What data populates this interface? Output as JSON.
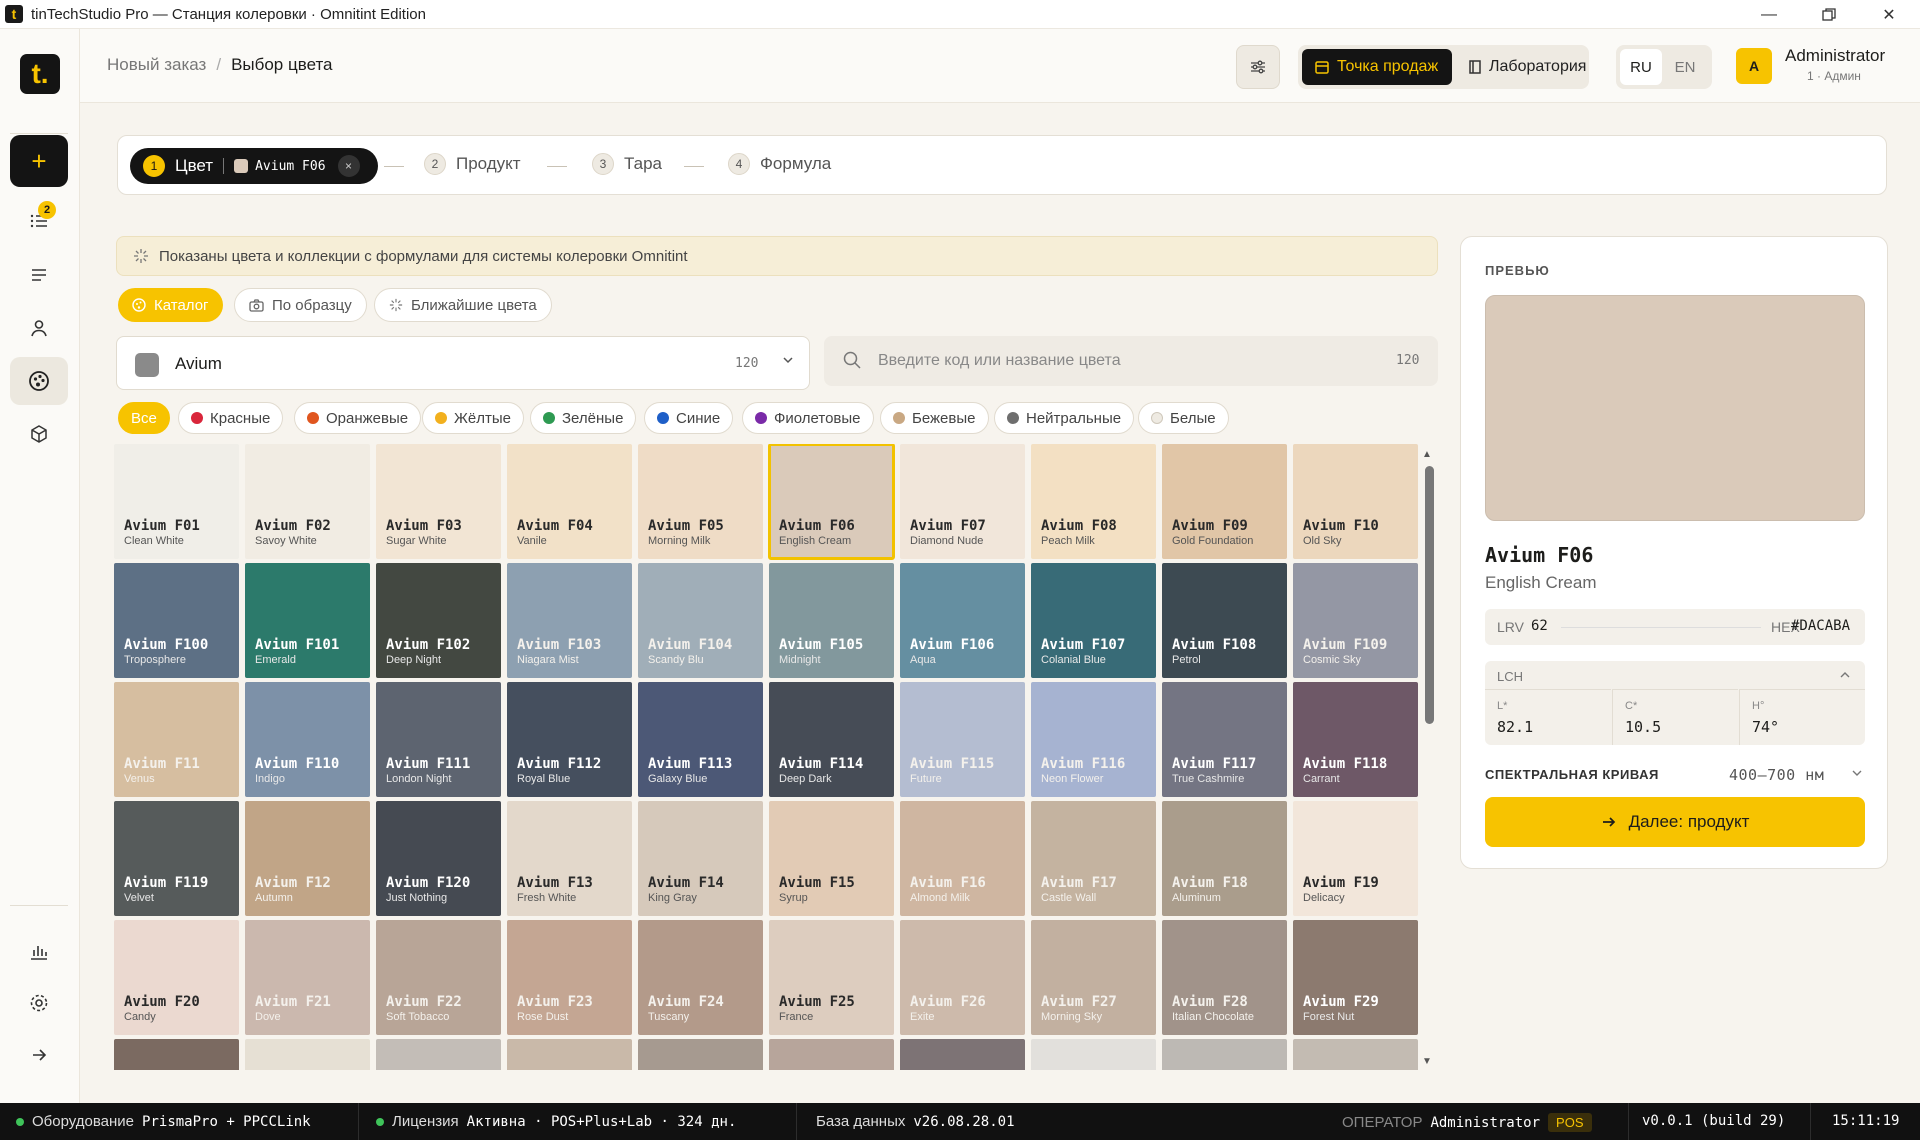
{
  "window": {
    "title": "tinTechStudio Pro — Станция колеровки · Omnitint Edition",
    "app_icon": "t"
  },
  "sidebar": {
    "logo": "t.",
    "orders_badge": "2"
  },
  "header": {
    "breadcrumb": [
      "Новый заказ",
      "Выбор цвета"
    ],
    "modes": [
      "Точка продаж",
      "Лаборатория"
    ],
    "langs": [
      "RU",
      "EN"
    ],
    "user": {
      "initial": "A",
      "name": "Administrator",
      "role": "1 · Админ"
    }
  },
  "stepper": {
    "steps": [
      {
        "num": "1",
        "label": "Цвет"
      },
      {
        "num": "2",
        "label": "Продукт"
      },
      {
        "num": "3",
        "label": "Тара"
      },
      {
        "num": "4",
        "label": "Формула"
      }
    ],
    "selected_code": "Avium F06",
    "remove_glyph": "×"
  },
  "banner": "Показаны цвета и коллекции с формулами для системы колеровки Omnitint",
  "mode_tabs": [
    "Каталог",
    "По образцу",
    "Ближайшие цвета"
  ],
  "collection": {
    "name": "Avium",
    "count": "120"
  },
  "search": {
    "placeholder": "Введите код или название цвета",
    "count": "120"
  },
  "filters": [
    {
      "label": "Все",
      "color": ""
    },
    {
      "label": "Красные",
      "color": "#d9263b"
    },
    {
      "label": "Оранжевые",
      "color": "#e0561f"
    },
    {
      "label": "Жёлтые",
      "color": "#f2b01e"
    },
    {
      "label": "Зелёные",
      "color": "#2e9a52"
    },
    {
      "label": "Синие",
      "color": "#1e5fc8"
    },
    {
      "label": "Фиолетовые",
      "color": "#7a2aa8"
    },
    {
      "label": "Бежевые",
      "color": "#c9a883"
    },
    {
      "label": "Нейтральные",
      "color": "#6e6e6e"
    },
    {
      "label": "Белые",
      "color": "#eeeae2"
    }
  ],
  "colors": [
    {
      "code": "Avium F01",
      "name": "Clean White",
      "hex": "#f0eee8"
    },
    {
      "code": "Avium F02",
      "name": "Savoy White",
      "hex": "#f1ece3"
    },
    {
      "code": "Avium F03",
      "name": "Sugar White",
      "hex": "#f2e5d4"
    },
    {
      "code": "Avium F04",
      "name": "Vanile",
      "hex": "#f2e1c8"
    },
    {
      "code": "Avium F05",
      "name": "Morning Milk",
      "hex": "#efdcc6"
    },
    {
      "code": "Avium F06",
      "name": "English Cream",
      "hex": "#dacaba"
    },
    {
      "code": "Avium F07",
      "name": "Diamond Nude",
      "hex": "#f1e6da"
    },
    {
      "code": "Avium F08",
      "name": "Peach Milk",
      "hex": "#f3e0c3"
    },
    {
      "code": "Avium F09",
      "name": "Gold Foundation",
      "hex": "#e1c6a7"
    },
    {
      "code": "Avium F10",
      "name": "Old Sky",
      "hex": "#ecd7bd"
    },
    {
      "code": "Avium F100",
      "name": "Troposphere",
      "hex": "#5d7085"
    },
    {
      "code": "Avium F101",
      "name": "Emerald",
      "hex": "#2c7a6b"
    },
    {
      "code": "Avium F102",
      "name": "Deep Night",
      "hex": "#434841"
    },
    {
      "code": "Avium F103",
      "name": "Niagara Mist",
      "hex": "#8da0b1"
    },
    {
      "code": "Avium F104",
      "name": "Scandy Blu",
      "hex": "#a0aeb8"
    },
    {
      "code": "Avium F105",
      "name": "Midnight",
      "hex": "#82989d"
    },
    {
      "code": "Avium F106",
      "name": "Aqua",
      "hex": "#658fa1"
    },
    {
      "code": "Avium F107",
      "name": "Colanial Blue",
      "hex": "#386b77"
    },
    {
      "code": "Avium F108",
      "name": "Petrol",
      "hex": "#3d4a52"
    },
    {
      "code": "Avium F109",
      "name": "Cosmic Sky",
      "hex": "#9497a4"
    },
    {
      "code": "Avium F11",
      "name": "Venus",
      "hex": "#d6bea0"
    },
    {
      "code": "Avium F110",
      "name": "Indigo",
      "hex": "#7d91a8"
    },
    {
      "code": "Avium F111",
      "name": "London Night",
      "hex": "#5d6470"
    },
    {
      "code": "Avium F112",
      "name": "Royal Blue",
      "hex": "#454f5e"
    },
    {
      "code": "Avium F113",
      "name": "Galaxy Blue",
      "hex": "#4c5876"
    },
    {
      "code": "Avium F114",
      "name": "Deep Dark",
      "hex": "#464c56"
    },
    {
      "code": "Avium F115",
      "name": "Future",
      "hex": "#b4bdd1"
    },
    {
      "code": "Avium F116",
      "name": "Neon Flower",
      "hex": "#a6b3d1"
    },
    {
      "code": "Avium F117",
      "name": "True Cashmire",
      "hex": "#747583"
    },
    {
      "code": "Avium F118",
      "name": "Carrant",
      "hex": "#6e5867"
    },
    {
      "code": "Avium F119",
      "name": "Velvet",
      "hex": "#565b5b"
    },
    {
      "code": "Avium F12",
      "name": "Autumn",
      "hex": "#c1a587"
    },
    {
      "code": "Avium F120",
      "name": "Just Nothing",
      "hex": "#454a52"
    },
    {
      "code": "Avium F13",
      "name": "Fresh White",
      "hex": "#e3d8cb"
    },
    {
      "code": "Avium F14",
      "name": "King Gray",
      "hex": "#d6c9bb"
    },
    {
      "code": "Avium F15",
      "name": "Syrup",
      "hex": "#e2cbb5"
    },
    {
      "code": "Avium F16",
      "name": "Almond Milk",
      "hex": "#cfb6a1"
    },
    {
      "code": "Avium F17",
      "name": "Castle Wall",
      "hex": "#c4b3a0"
    },
    {
      "code": "Avium F18",
      "name": "Aluminum",
      "hex": "#aa9d8c"
    },
    {
      "code": "Avium F19",
      "name": "Delicacy",
      "hex": "#f2e6da"
    },
    {
      "code": "Avium F20",
      "name": "Candy",
      "hex": "#ebd9d0"
    },
    {
      "code": "Avium F21",
      "name": "Dove",
      "hex": "#cbb8ae"
    },
    {
      "code": "Avium F22",
      "name": "Soft Tobacco",
      "hex": "#b8a597"
    },
    {
      "code": "Avium F23",
      "name": "Rose Dust",
      "hex": "#c4a693"
    },
    {
      "code": "Avium F24",
      "name": "Tuscany",
      "hex": "#b39a8a"
    },
    {
      "code": "Avium F25",
      "name": "France",
      "hex": "#ddcdbf"
    },
    {
      "code": "Avium F26",
      "name": "Exite",
      "hex": "#cdbaab"
    },
    {
      "code": "Avium F27",
      "name": "Morning Sky",
      "hex": "#c2b0a0"
    },
    {
      "code": "Avium F28",
      "name": "Italian Chocolate",
      "hex": "#a1938a"
    },
    {
      "code": "Avium F29",
      "name": "Forest Nut",
      "hex": "#8c7a6f"
    },
    {
      "code": "",
      "name": "",
      "hex": "#7b6a61"
    },
    {
      "code": "",
      "name": "",
      "hex": "#e6e0d4"
    },
    {
      "code": "",
      "name": "",
      "hex": "#c3bdb7"
    },
    {
      "code": "",
      "name": "",
      "hex": "#c9b9a9"
    },
    {
      "code": "",
      "name": "",
      "hex": "#a69a90"
    },
    {
      "code": "",
      "name": "",
      "hex": "#b7a59b"
    },
    {
      "code": "",
      "name": "",
      "hex": "#7d7375"
    },
    {
      "code": "",
      "name": "",
      "hex": "#e2e0dc"
    },
    {
      "code": "",
      "name": "",
      "hex": "#bdb9b4"
    },
    {
      "code": "",
      "name": "",
      "hex": "#c3bbb2"
    }
  ],
  "selected_color_code": "Avium F06",
  "preview": {
    "label": "ПРЕВЬЮ",
    "code": "Avium F06",
    "name": "English Cream",
    "hex_color": "#dacaba",
    "lrv_label": "LRV",
    "lrv": "62",
    "hex_label": "HEX",
    "hex": "#DACABA",
    "lch_label": "LCH",
    "l_label": "L*",
    "l": "82.1",
    "c_label": "C*",
    "c": "10.5",
    "h_label": "H°",
    "h": "74°",
    "spectral_label": "СПЕКТРАЛЬНАЯ КРИВАЯ",
    "spectral_range": "400–700 нм",
    "next_label": "Далее: продукт"
  },
  "status": {
    "equipment_label": "Оборудование",
    "equipment_value": "PrismaPro + PPCCLink",
    "license_label": "Лицензия",
    "license_value": "Активна · POS+Plus+Lab · 324 дн.",
    "db_label": "База данных",
    "db_value": "v26.08.28.01",
    "operator_label": "ОПЕРАТОР",
    "operator_value": "Administrator",
    "mode_badge": "POS",
    "version": "v0.0.1 (build 29)",
    "time": "15:11:19"
  }
}
